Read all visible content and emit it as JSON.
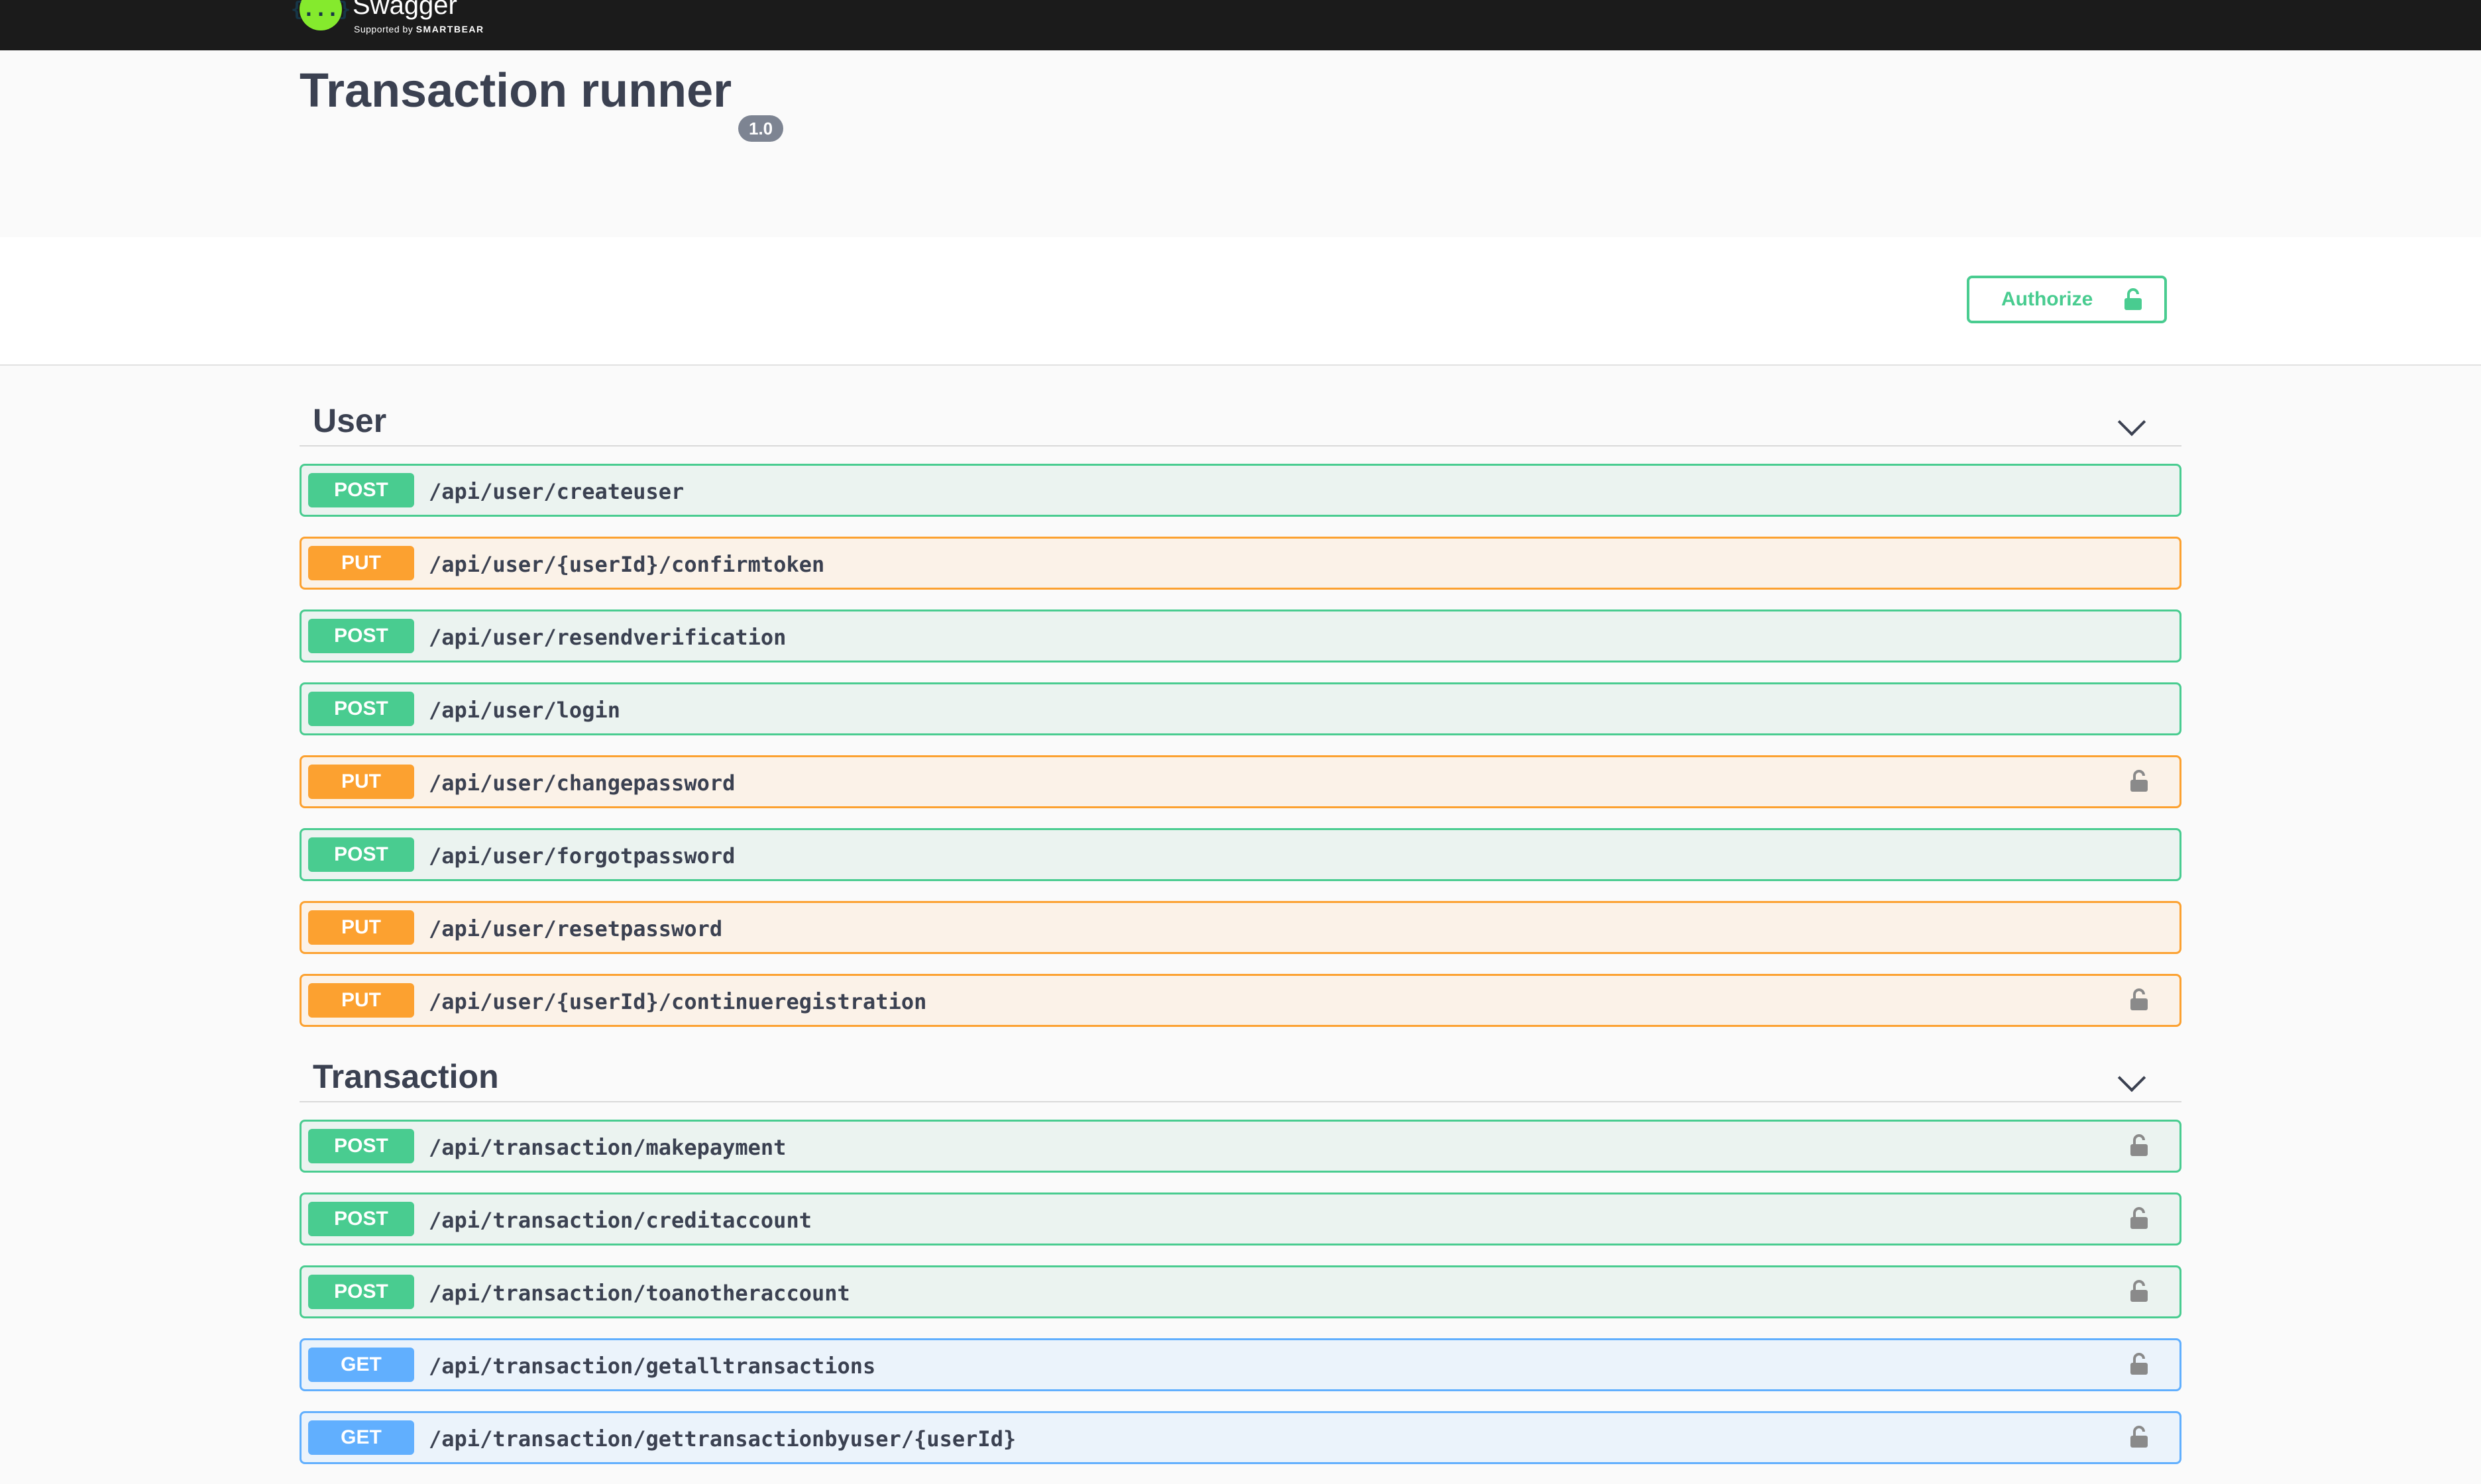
{
  "header": {
    "logo": {
      "name": "Swagger",
      "mark": "{...}",
      "supported_prefix": "Supported by",
      "supported_brand": "SMARTBEAR",
      "brand_color": "#85ea2d"
    }
  },
  "info": {
    "title": "Transaction runner",
    "version": "1.0"
  },
  "authorize": {
    "label": "Authorize",
    "icon": "lock-icon",
    "color": "#49cc90"
  },
  "method_colors": {
    "POST": "#49cc90",
    "PUT": "#fca130",
    "GET": "#61affe"
  },
  "tags": [
    {
      "name": "User",
      "expanded": true,
      "operations": [
        {
          "method": "POST",
          "path": "/api/user/createuser",
          "locked": false
        },
        {
          "method": "PUT",
          "path": "/api/user/{userId}/confirmtoken",
          "locked": false
        },
        {
          "method": "POST",
          "path": "/api/user/resendverification",
          "locked": false
        },
        {
          "method": "POST",
          "path": "/api/user/login",
          "locked": false
        },
        {
          "method": "PUT",
          "path": "/api/user/changepassword",
          "locked": true
        },
        {
          "method": "POST",
          "path": "/api/user/forgotpassword",
          "locked": false
        },
        {
          "method": "PUT",
          "path": "/api/user/resetpassword",
          "locked": false
        },
        {
          "method": "PUT",
          "path": "/api/user/{userId}/continueregistration",
          "locked": true
        }
      ]
    },
    {
      "name": "Transaction",
      "expanded": true,
      "operations": [
        {
          "method": "POST",
          "path": "/api/transaction/makepayment",
          "locked": true
        },
        {
          "method": "POST",
          "path": "/api/transaction/creditaccount",
          "locked": true
        },
        {
          "method": "POST",
          "path": "/api/transaction/toanotheraccount",
          "locked": true
        },
        {
          "method": "GET",
          "path": "/api/transaction/getalltransactions",
          "locked": true
        },
        {
          "method": "GET",
          "path": "/api/transaction/gettransactionbyuser/{userId}",
          "locked": true
        }
      ]
    }
  ]
}
